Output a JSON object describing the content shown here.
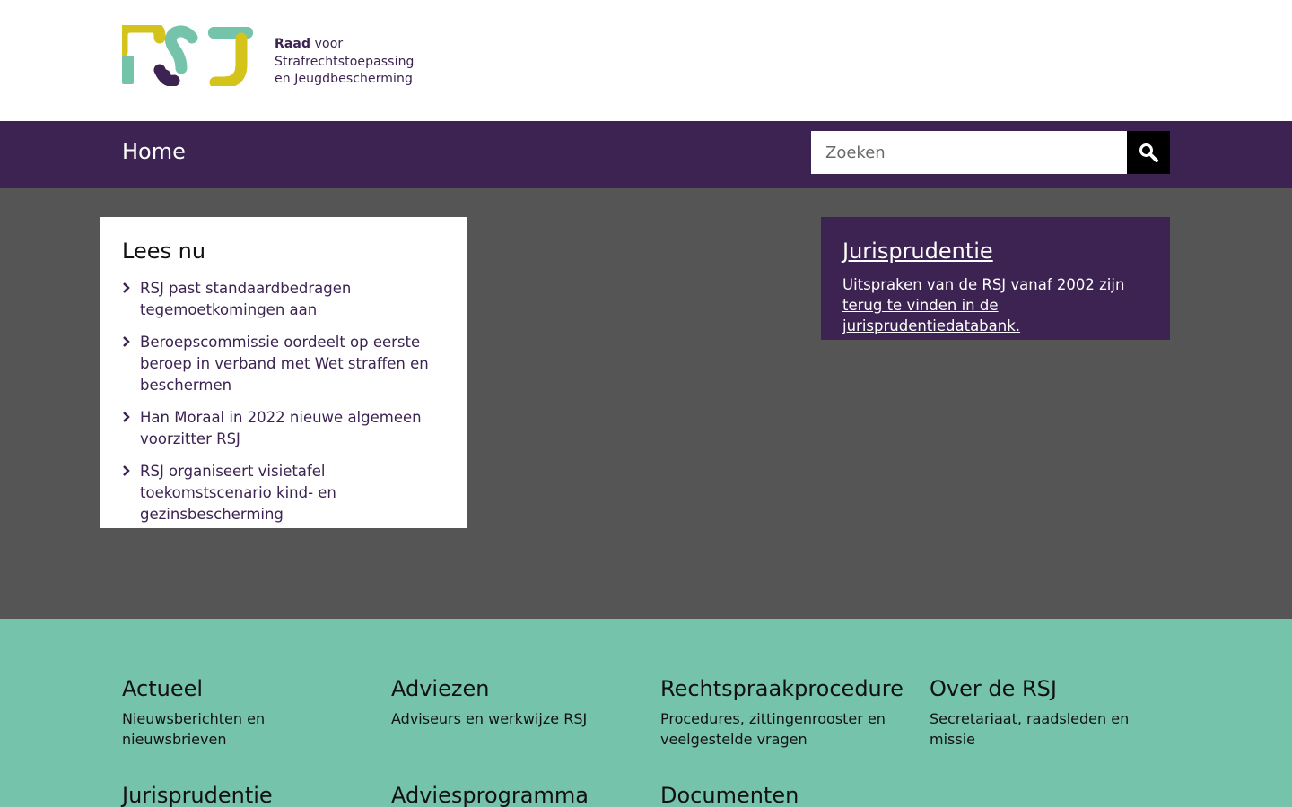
{
  "header": {
    "logo_letters": "RSJ",
    "logo_line1_strong": "Raad",
    "logo_line1_rest": " voor",
    "logo_line2": "Strafrechtstoepassing",
    "logo_line3": "en Jeugdbescherming"
  },
  "nav": {
    "home_label": "Home",
    "search_placeholder": "Zoeken",
    "search_icon": "search-icon"
  },
  "lees_nu": {
    "title": "Lees nu",
    "items": [
      "RSJ past standaardbedragen tegemoetkomingen aan",
      "Beroepscommissie oordeelt op eerste beroep in verband met Wet straffen en beschermen",
      "Han Moraal in 2022 nieuwe algemeen voorzitter RSJ",
      "RSJ organiseert visietafel toekomstscenario kind- en gezinsbescherming"
    ]
  },
  "jurisprudentie_card": {
    "title": "Jurisprudentie",
    "text": "Uitspraken van de RSJ vanaf 2002 zijn terug te vinden in de jurisprudentiedatabank."
  },
  "footer": {
    "columns": [
      {
        "title": "Actueel",
        "text": "Nieuwsberichten en nieuwsbrieven"
      },
      {
        "title": "Adviezen",
        "text": "Adviseurs en werkwijze RSJ"
      },
      {
        "title": "Rechtspraakprocedure",
        "text": "Procedures, zittingenrooster en veelgestelde vragen"
      },
      {
        "title": "Over de RSJ",
        "text": "Secretariaat, raadsleden en missie"
      },
      {
        "title": "Jurisprudentie",
        "text": ""
      },
      {
        "title": "Adviesprogramma",
        "text": ""
      },
      {
        "title": "Documenten",
        "text": ""
      }
    ]
  },
  "colors": {
    "brand_purple": "#3c2352",
    "main_gray": "#555555",
    "footer_green": "#76c3ac",
    "logo_yellow": "#d4c31a",
    "logo_teal": "#76c3ac"
  }
}
